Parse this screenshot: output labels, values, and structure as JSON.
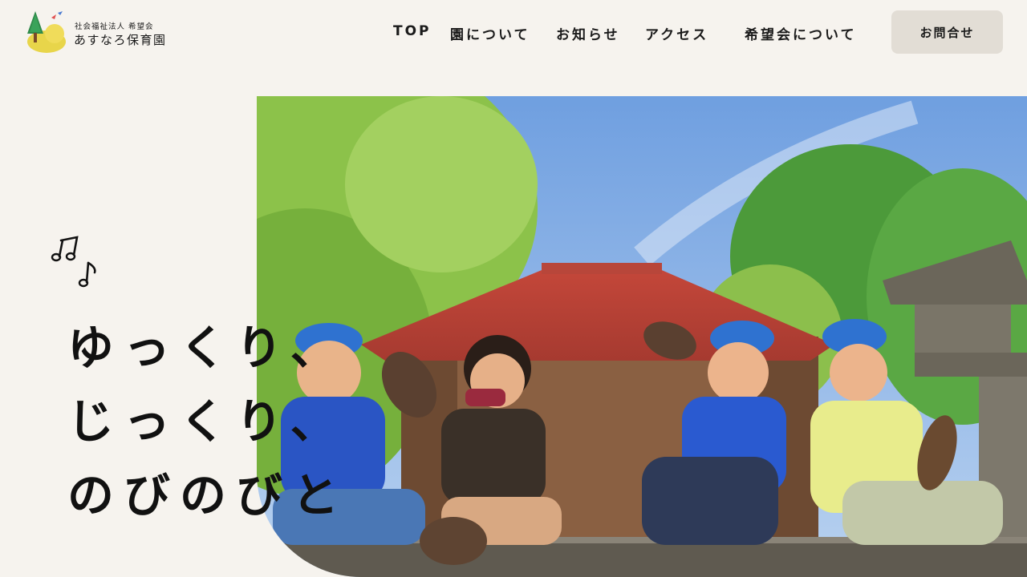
{
  "header": {
    "logo": {
      "org": "社会福祉法人 希望会",
      "name": "あすなろ保育園",
      "icon": "tree-logo-icon"
    },
    "nav": [
      {
        "label": "TOP"
      },
      {
        "label": "園について"
      },
      {
        "label": "お知らせ"
      },
      {
        "label": "アクセス"
      },
      {
        "label": "希望会について"
      }
    ],
    "contact_label": "お問合せ"
  },
  "hero": {
    "catch_lines": [
      "ゆっくり、",
      "じっくり、",
      "のびのびと"
    ],
    "notes_icon": "music-notes-icon",
    "photo_subject": "children-sitting-on-shrine-steps"
  },
  "colors": {
    "background": "#f6f3ee",
    "button_bg": "#e2ddd5",
    "text": "#1a1a1a"
  }
}
